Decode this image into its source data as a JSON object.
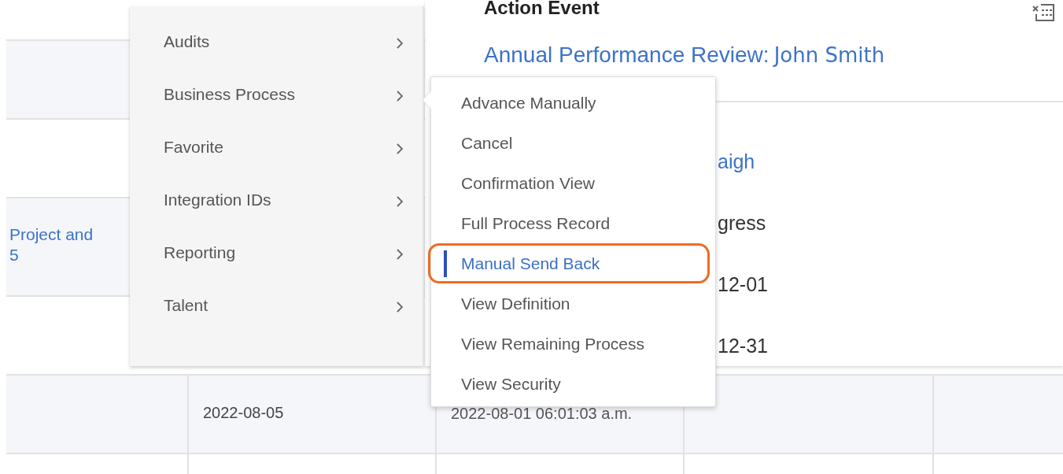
{
  "table": {
    "partial_link": {
      "line_1": "Project and",
      "line_2": "5"
    },
    "date_row": {
      "column_2": "2022-08-05",
      "column_3": "2022-08-01 06:01:03 a.m."
    }
  },
  "menu": {
    "items": [
      {
        "label": "Audits"
      },
      {
        "label": "Business Process"
      },
      {
        "label": "Favorite"
      },
      {
        "label": "Integration IDs"
      },
      {
        "label": "Reporting"
      },
      {
        "label": "Talent"
      }
    ]
  },
  "detail": {
    "title": "Action Event",
    "subject_label": "Annual Performance Review:",
    "subject_name": "John Smith",
    "partial_values": [
      {
        "text": "aigh",
        "kind": "link"
      },
      {
        "text": "gress",
        "kind": "text"
      },
      {
        "text": "12-01",
        "kind": "text"
      },
      {
        "text": "12-31",
        "kind": "text"
      }
    ]
  },
  "submenu": {
    "items": [
      {
        "label": "Advance Manually",
        "selected": false
      },
      {
        "label": "Cancel",
        "selected": false
      },
      {
        "label": "Confirmation View",
        "selected": false
      },
      {
        "label": "Full Process Record",
        "selected": false
      },
      {
        "label": "Manual Send Back",
        "selected": true
      },
      {
        "label": "View Definition",
        "selected": false
      },
      {
        "label": "View Remaining Process",
        "selected": false
      },
      {
        "label": "View Security",
        "selected": false
      }
    ]
  }
}
